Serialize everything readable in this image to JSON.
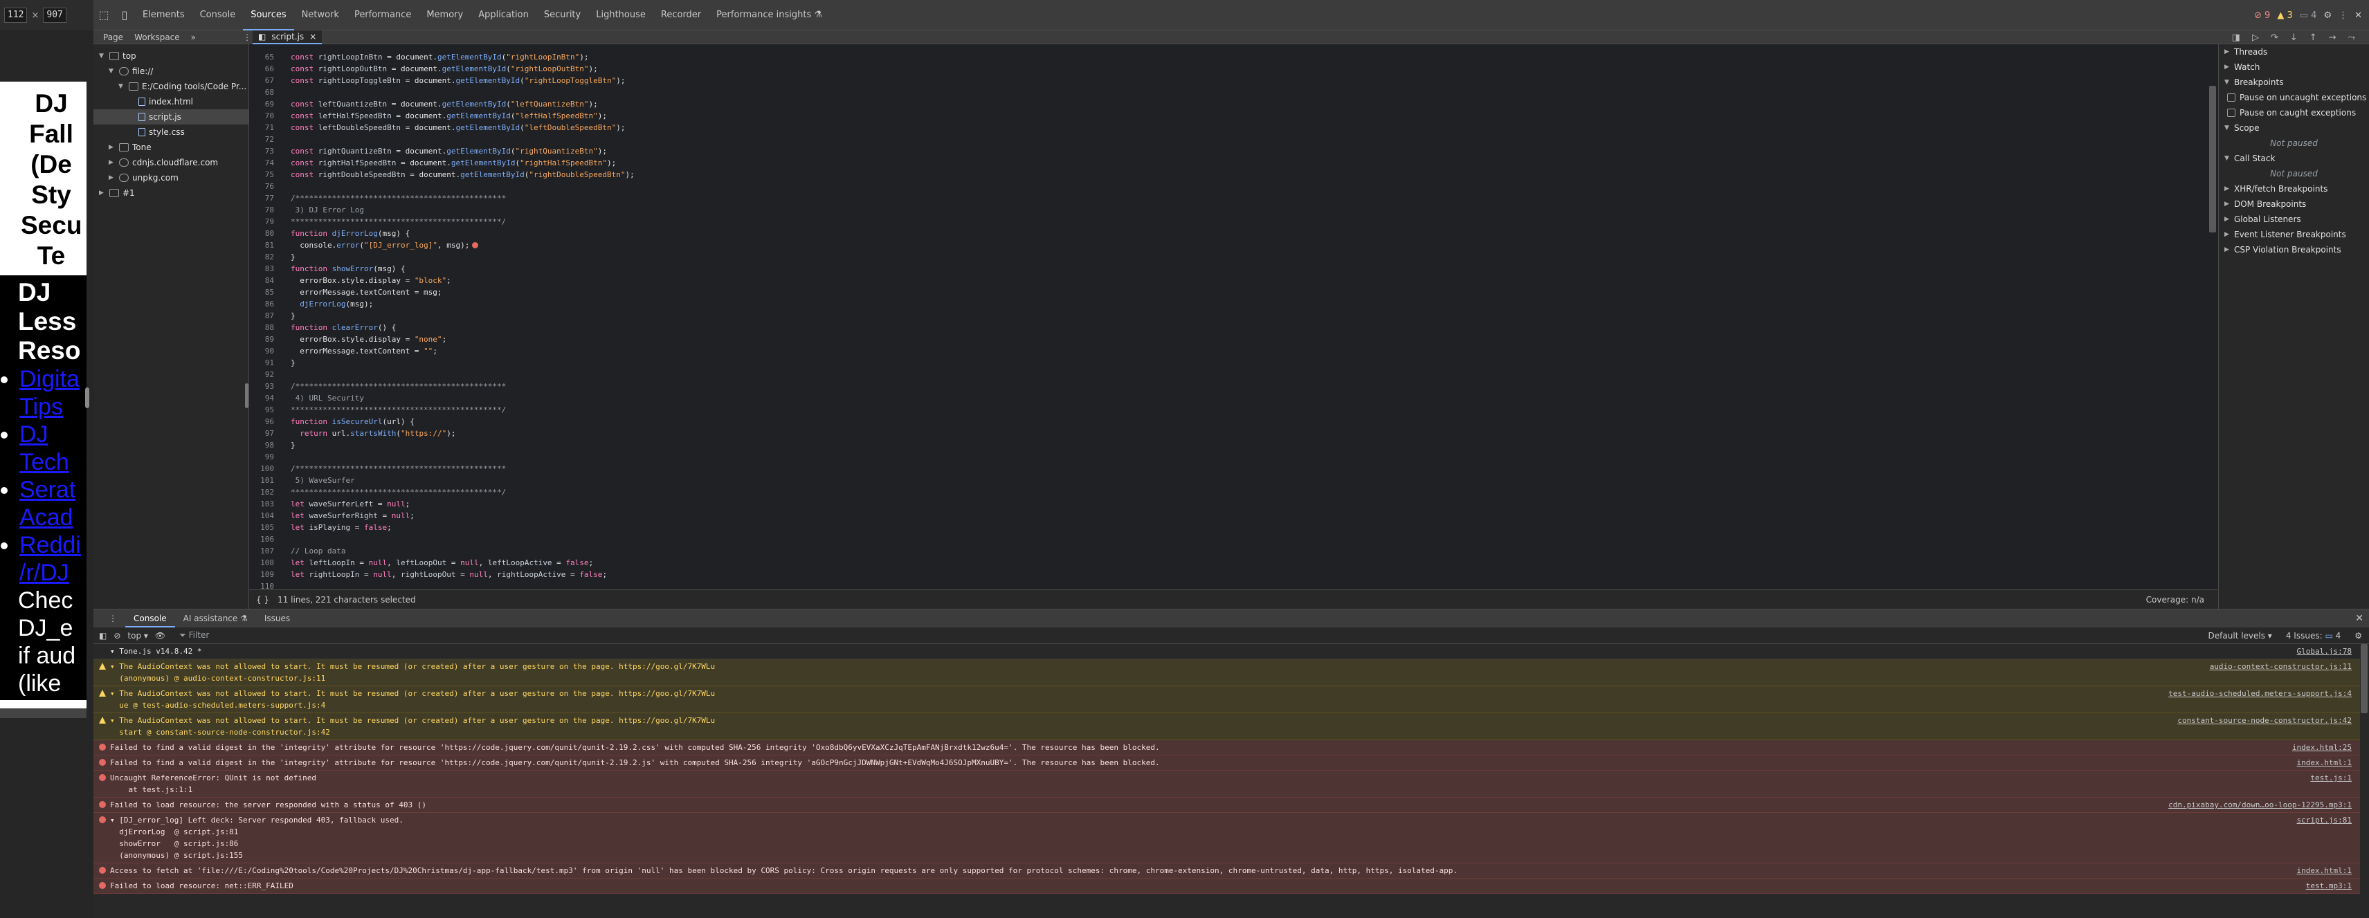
{
  "viewport": {
    "width": "112",
    "height": "907",
    "separator": "×"
  },
  "preview": {
    "title": "DJ Fall (De Sty Secu Te",
    "title_lines": [
      "DJ",
      "Fall",
      "(De",
      "Sty",
      "Secu",
      "Te"
    ],
    "section_lines": [
      "DJ",
      "Less",
      "Reso"
    ],
    "links": [
      "Digita Tips",
      "DJ Tech",
      "Serat Acad",
      "Reddi /r/DJ"
    ],
    "para": "Chec DJ_e if aud (like"
  },
  "tabs": [
    "Elements",
    "Console",
    "Sources",
    "Network",
    "Performance",
    "Memory",
    "Application",
    "Security",
    "Lighthouse",
    "Recorder",
    "Performance insights ⚗"
  ],
  "active_tab": "Sources",
  "status": {
    "errors": "9",
    "warnings": "3",
    "issues": "4"
  },
  "sources": {
    "nav_tabs": [
      "Page",
      "Workspace",
      "»"
    ],
    "open_file": "script.js",
    "tree": [
      {
        "label": "top",
        "type": "frame",
        "indent": 0,
        "open": true
      },
      {
        "label": "file://",
        "type": "cloud",
        "indent": 1,
        "open": true
      },
      {
        "label": "E:/Coding tools/Code Pr...",
        "type": "folder",
        "indent": 2,
        "open": true
      },
      {
        "label": "index.html",
        "type": "file",
        "indent": 3
      },
      {
        "label": "script.js",
        "type": "file",
        "indent": 3,
        "selected": true
      },
      {
        "label": "style.css",
        "type": "file",
        "indent": 3
      },
      {
        "label": "Tone",
        "type": "folder",
        "indent": 1,
        "open": false
      },
      {
        "label": "cdnjs.cloudflare.com",
        "type": "cloud",
        "indent": 1,
        "open": false
      },
      {
        "label": "unpkg.com",
        "type": "cloud",
        "indent": 1,
        "open": false
      },
      {
        "label": "#1",
        "type": "frame",
        "indent": 0,
        "open": false
      }
    ],
    "line_numbers": [
      "65",
      "66",
      "67",
      "68",
      "69",
      "70",
      "71",
      "72",
      "73",
      "74",
      "75",
      "76",
      "77",
      "78",
      "79",
      "80",
      "81",
      "82",
      "83",
      "84",
      "85",
      "86",
      "87",
      "88",
      "89",
      "90",
      "91",
      "92",
      "93",
      "94",
      "95",
      "96",
      "97",
      "98",
      "99",
      "100",
      "101",
      "102",
      "103",
      "104",
      "105",
      "106",
      "107",
      "108",
      "109",
      "110"
    ],
    "status_left": "11 lines, 221 characters selected",
    "status_right": "Coverage: n/a"
  },
  "debugger": {
    "sections": [
      {
        "label": "Threads",
        "open": false
      },
      {
        "label": "Watch",
        "open": false
      },
      {
        "label": "Breakpoints",
        "open": true
      }
    ],
    "bp_options": [
      "Pause on uncaught exceptions",
      "Pause on caught exceptions"
    ],
    "scope": "Scope",
    "not_paused": "Not paused",
    "call_stack": "Call Stack",
    "more": [
      "XHR/fetch Breakpoints",
      "DOM Breakpoints",
      "Global Listeners",
      "Event Listener Breakpoints",
      "CSP Violation Breakpoints"
    ]
  },
  "drawer": {
    "tabs": [
      "Console",
      "AI assistance ⚗",
      "Issues"
    ],
    "context": "top ▾",
    "filter_placeholder": "Filter",
    "levels": "Default levels ▾",
    "issues": "4 Issues: ",
    "issues_count": "4"
  },
  "console": [
    {
      "kind": "plain",
      "text": "▾ Tone.js v14.8.42 *",
      "src": "Global.js:78"
    },
    {
      "kind": "w",
      "text": "▾ The AudioContext was not allowed to start. It must be resumed (or created) after a user gesture on the page. https://goo.gl/7K7WLu\n  (anonymous) @ audio-context-constructor.js:11",
      "src": "audio-context-constructor.js:11"
    },
    {
      "kind": "w",
      "text": "▾ The AudioContext was not allowed to start. It must be resumed (or created) after a user gesture on the page. https://goo.gl/7K7WLu\n  ue @ test-audio-scheduled.meters-support.js:4",
      "src": "test-audio-scheduled.meters-support.js:4"
    },
    {
      "kind": "w",
      "text": "▾ The AudioContext was not allowed to start. It must be resumed (or created) after a user gesture on the page. https://goo.gl/7K7WLu\n  start @ constant-source-node-constructor.js:42",
      "src": "constant-source-node-constructor.js:42"
    },
    {
      "kind": "e",
      "text": "Failed to find a valid digest in the 'integrity' attribute for resource 'https://code.jquery.com/qunit/qunit-2.19.2.css' with computed SHA-256 integrity 'Oxo8dbQ6yvEVXaXCzJqTEpAmFANjBrxdtk12wz6u4='. The resource has been blocked.",
      "src": "index.html:25"
    },
    {
      "kind": "e",
      "text": "Failed to find a valid digest in the 'integrity' attribute for resource 'https://code.jquery.com/qunit/qunit-2.19.2.js' with computed SHA-256 integrity 'aGOcP9nGcjJDWNWpjGNt+EVdWqMo4J6SOJpMXnuUBY='. The resource has been blocked.",
      "src": "index.html:1"
    },
    {
      "kind": "e",
      "text": "Uncaught ReferenceError: QUnit is not defined\n    at test.js:1:1",
      "src": "test.js:1"
    },
    {
      "kind": "e",
      "text": "Failed to load resource: the server responded with a status of 403 ()",
      "src": "cdn.pixabay.com/down…oo-loop-12295.mp3:1"
    },
    {
      "kind": "e",
      "text": "▾ [DJ_error_log] Left deck: Server responded 403, fallback used.\n  djErrorLog  @ script.js:81\n  showError   @ script.js:86\n  (anonymous) @ script.js:155",
      "src": "script.js:81"
    },
    {
      "kind": "e",
      "text": "Access to fetch at 'file:///E:/Coding%20tools/Code%20Projects/DJ%20Christmas/dj-app-fallback/test.mp3' from origin 'null' has been blocked by CORS policy: Cross origin requests are only supported for protocol schemes: chrome, chrome-extension, chrome-untrusted, data, http, https, isolated-app.",
      "src": "index.html:1"
    },
    {
      "kind": "e",
      "text": "Failed to load resource: net::ERR_FAILED",
      "src": "test.mp3:1"
    }
  ],
  "colors": {
    "accent": "#7cacf8",
    "error": "#e46962",
    "warning": "#fdd663"
  }
}
